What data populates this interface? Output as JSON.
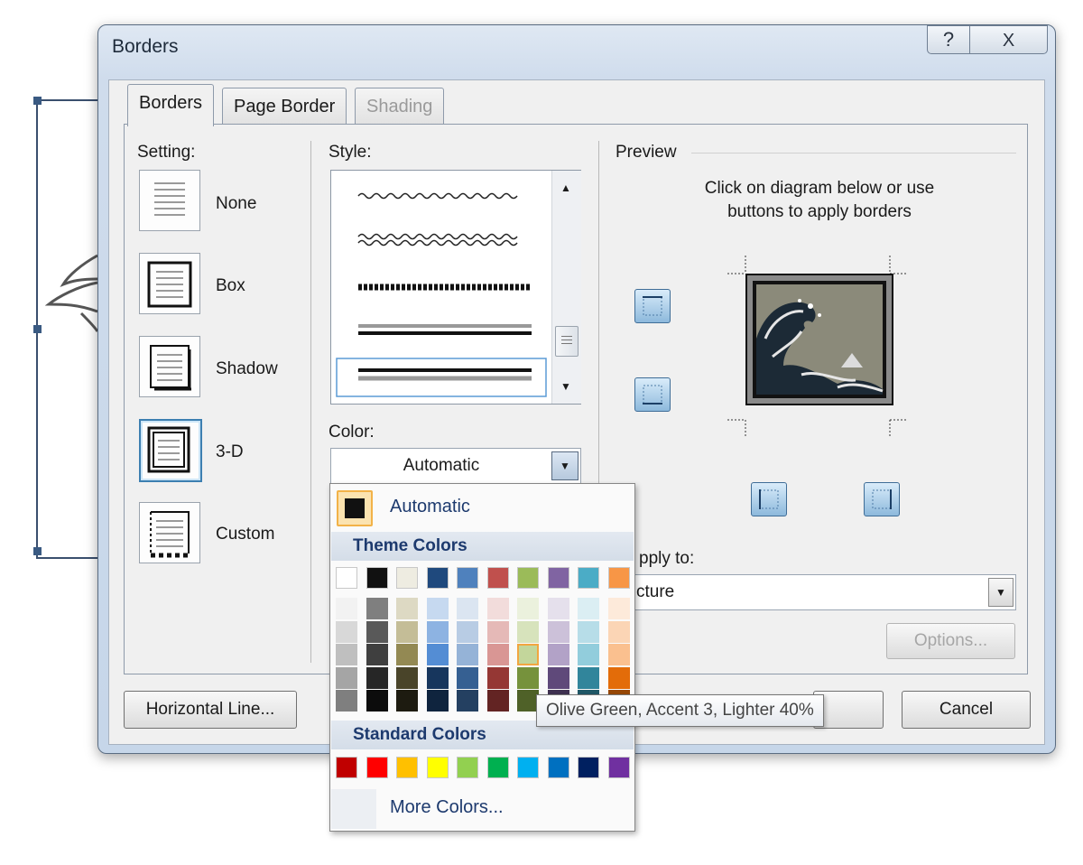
{
  "window": {
    "title": "Borders",
    "help_glyph": "?",
    "close_glyph": "X"
  },
  "tabs": [
    {
      "label": "Borders"
    },
    {
      "label": "Page Border"
    },
    {
      "label": "Shading"
    }
  ],
  "setting": {
    "label": "Setting:",
    "options": [
      {
        "label": "None"
      },
      {
        "label": "Box"
      },
      {
        "label": "Shadow"
      },
      {
        "label": "3-D"
      },
      {
        "label": "Custom"
      }
    ]
  },
  "style": {
    "label": "Style:"
  },
  "color": {
    "label": "Color:",
    "value": "Automatic"
  },
  "preview": {
    "label": "Preview",
    "hint_line1": "Click on diagram below or use",
    "hint_line2": "buttons to apply borders"
  },
  "apply_to": {
    "label": "pply to:",
    "value": "cture"
  },
  "buttons": {
    "options": "Options...",
    "horizontal_line": "Horizontal Line...",
    "cancel": "Cancel"
  },
  "color_popup": {
    "automatic_label": "Automatic",
    "theme_colors_label": "Theme Colors",
    "standard_colors_label": "Standard Colors",
    "more_colors_label": "More Colors...",
    "theme_top": [
      "#ffffff",
      "#111111",
      "#eeece1",
      "#1f497d",
      "#4f81bd",
      "#c0504d",
      "#9bbb59",
      "#8064a2",
      "#4bacc6",
      "#f79646"
    ],
    "theme_shades": [
      [
        "#f2f2f2",
        "#d8d8d8",
        "#bfbfbf",
        "#a5a5a5",
        "#7f7f7f"
      ],
      [
        "#7f7f7f",
        "#595959",
        "#3f3f3f",
        "#262626",
        "#0c0c0c"
      ],
      [
        "#ddd9c3",
        "#c4bd97",
        "#938953",
        "#494429",
        "#1d1b10"
      ],
      [
        "#c6d9f0",
        "#8db3e2",
        "#548dd4",
        "#17365d",
        "#0f243e"
      ],
      [
        "#dbe5f1",
        "#b8cce4",
        "#95b3d7",
        "#366092",
        "#244061"
      ],
      [
        "#f2dcdb",
        "#e5b9b7",
        "#d99694",
        "#953734",
        "#632423"
      ],
      [
        "#ebf1dd",
        "#d7e3bc",
        "#c3d69b",
        "#76923c",
        "#4f6128"
      ],
      [
        "#e5e0ec",
        "#ccc1d9",
        "#b2a2c7",
        "#5f497a",
        "#3f3151"
      ],
      [
        "#dbeef3",
        "#b7dde8",
        "#92cddc",
        "#31859b",
        "#205867"
      ],
      [
        "#fdeada",
        "#fbd5b5",
        "#fac08f",
        "#e36c09",
        "#974806"
      ]
    ],
    "standard": [
      "#c00000",
      "#ff0000",
      "#ffc000",
      "#ffff00",
      "#92d050",
      "#00b050",
      "#00b0f0",
      "#0070c0",
      "#002060",
      "#7030a0"
    ],
    "hovered_tooltip": "Olive Green, Accent 3, Lighter 40%"
  },
  "colors": {
    "accent": "#3c7fb1",
    "popup_section_text": "#1d3a6e"
  }
}
